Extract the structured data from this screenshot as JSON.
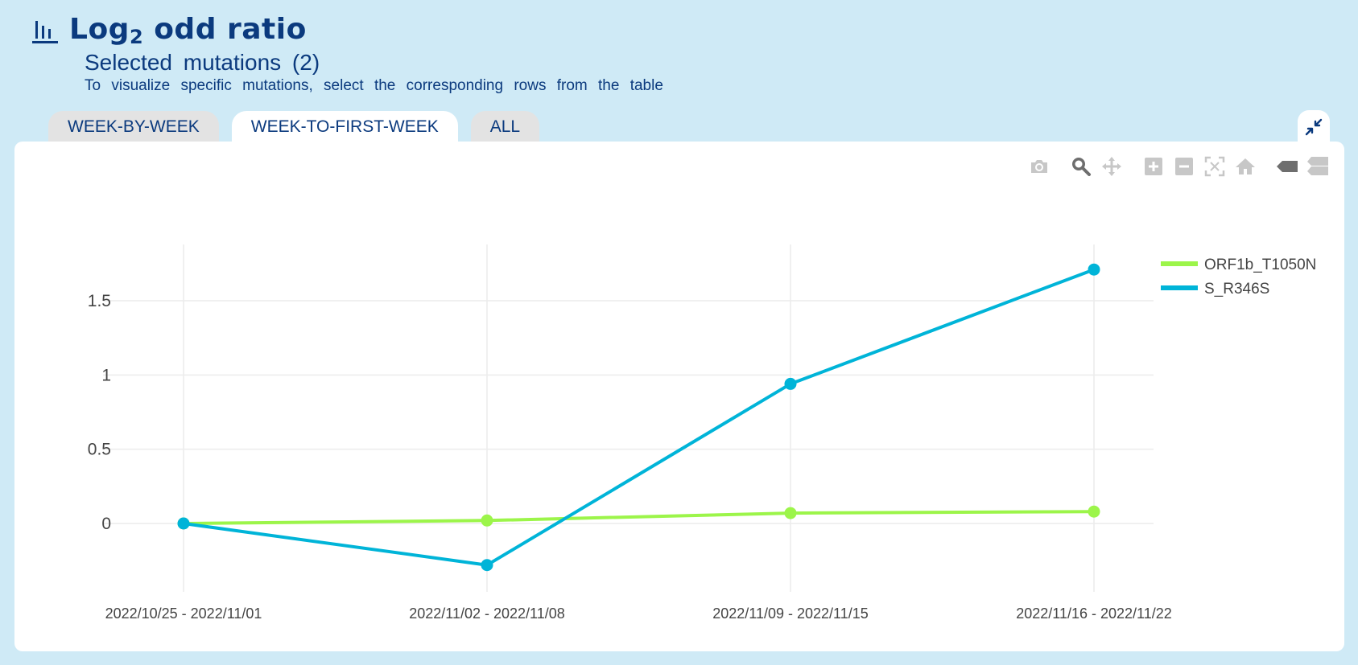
{
  "header": {
    "title_prefix": "Log",
    "title_sub": "2",
    "title_suffix": " odd ratio",
    "subtitle": "Selected mutations (2)",
    "hint": "To visualize specific mutations, select the corresponding rows from the table"
  },
  "tabs": [
    {
      "label": "WEEK-BY-WEEK",
      "active": false
    },
    {
      "label": "WEEK-TO-FIRST-WEEK",
      "active": true
    },
    {
      "label": "ALL",
      "active": false
    }
  ],
  "toolbar": [
    "camera-icon",
    "zoom-icon",
    "pan-icon",
    "zoom-in-icon",
    "zoom-out-icon",
    "autoscale-icon",
    "home-icon",
    "hover-closest-icon",
    "hover-compare-icon"
  ],
  "chart_data": {
    "type": "line",
    "categories": [
      "2022/10/25 - 2022/11/01",
      "2022/11/02 - 2022/11/08",
      "2022/11/09 - 2022/11/15",
      "2022/11/16 - 2022/11/22"
    ],
    "y_ticks": [
      "0",
      "0.5",
      "1",
      "1.5"
    ],
    "y_tick_values": [
      0,
      0.5,
      1,
      1.5
    ],
    "ylim": [
      -0.4,
      1.87
    ],
    "grid": true,
    "legend_placement": "top-right",
    "series": [
      {
        "name": "ORF1b_T1050N",
        "color": "#9cf54a",
        "values": [
          0,
          0.02,
          0.07,
          0.08
        ]
      },
      {
        "name": "S_R346S",
        "color": "#00b4d8",
        "values": [
          0,
          -0.28,
          0.94,
          1.71
        ]
      }
    ]
  }
}
